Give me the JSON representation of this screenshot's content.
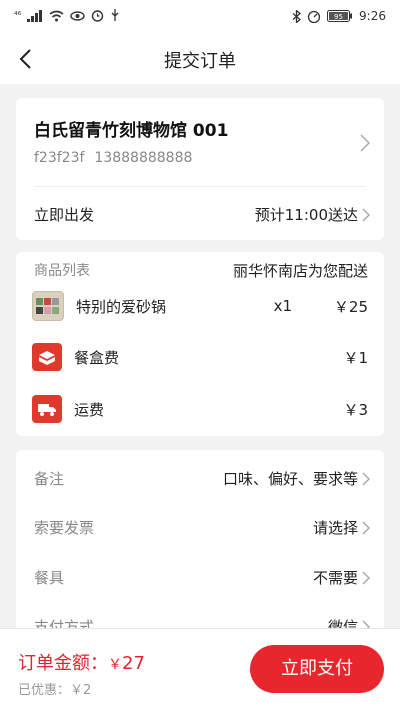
{
  "status_bar": {
    "time": "9:26",
    "network_badge": "⁴⁶",
    "battery": "95"
  },
  "header": {
    "title": "提交订单"
  },
  "address": {
    "store_name": "白氏留青竹刻博物馆 001",
    "contact_name": "f23f23f",
    "contact_phone": "13888888888",
    "depart_label": "立即出发",
    "eta": "预计11:00送达"
  },
  "goods": {
    "header": "商品列表",
    "delivery_store": "丽华怀南店为您配送",
    "items": [
      {
        "name": "特别的爱砂锅",
        "qty": "x1",
        "price": "￥25",
        "icon": "food-thumbnail"
      },
      {
        "name": "餐盒费",
        "qty": "",
        "price": "￥1",
        "icon": "lunchbox-icon"
      },
      {
        "name": "运费",
        "qty": "",
        "price": "￥3",
        "icon": "truck-icon"
      }
    ]
  },
  "options": [
    {
      "label": "备注",
      "value": "口味、偏好、要求等"
    },
    {
      "label": "索要发票",
      "value": "请选择"
    },
    {
      "label": "餐具",
      "value": "不需要"
    },
    {
      "label": "支付方式",
      "value": "微信"
    }
  ],
  "footer": {
    "total_label": "订单金额：",
    "total_currency": "￥",
    "total_amount": "27",
    "discount": "已优惠：￥2",
    "pay_button": "立即支付"
  },
  "colors": {
    "accent": "#e8262d",
    "page_bg": "#f2f2f2"
  }
}
